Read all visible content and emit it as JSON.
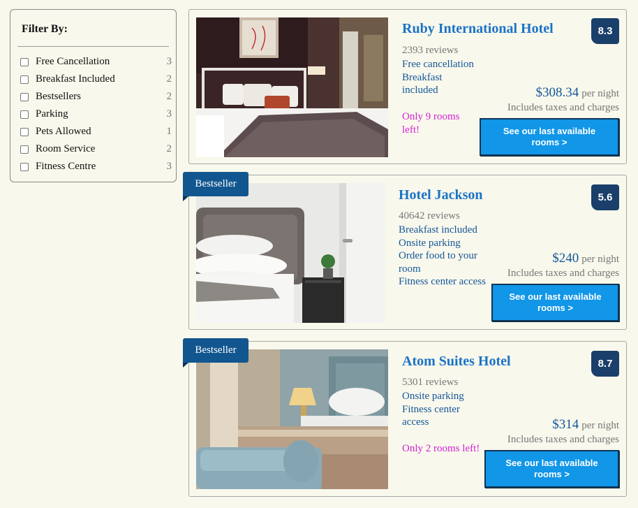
{
  "filter": {
    "title": "Filter By:",
    "options": [
      {
        "label": "Free Cancellation",
        "count": "3"
      },
      {
        "label": "Breakfast Included",
        "count": "2"
      },
      {
        "label": "Bestsellers",
        "count": "2"
      },
      {
        "label": "Parking",
        "count": "3"
      },
      {
        "label": "Pets Allowed",
        "count": "1"
      },
      {
        "label": "Room Service",
        "count": "2"
      },
      {
        "label": "Fitness Centre",
        "count": "3"
      }
    ]
  },
  "hotels": [
    {
      "name": "Ruby International Hotel",
      "score": "8.3",
      "reviews": "2393 reviews",
      "features": [
        "Free cancellation",
        "Breakfast",
        "included"
      ],
      "scarcity": [
        "Only 9 rooms",
        "left!"
      ],
      "price": "$308.34",
      "per_night": "per night",
      "taxes": "Includes taxes and charges",
      "cta": [
        "See our last available",
        "rooms >"
      ]
    },
    {
      "ribbon": "Bestseller",
      "name": "Hotel Jackson",
      "score": "5.6",
      "reviews": "40642 reviews",
      "features": [
        "Breakfast included",
        "Onsite parking",
        "Order food to your",
        "room",
        "Fitness center access"
      ],
      "price": "$240",
      "per_night": "per night",
      "taxes": "Includes taxes and charges",
      "cta": [
        "See our last available",
        "rooms >"
      ]
    },
    {
      "ribbon": "Bestseller",
      "name": "Atom Suites Hotel",
      "score": "8.7",
      "reviews": "5301 reviews",
      "features": [
        "Onsite parking",
        "Fitness center",
        "access"
      ],
      "scarcity": [
        "Only 2 rooms left!"
      ],
      "price": "$314",
      "per_night": "per night",
      "taxes": "Includes taxes and charges",
      "cta": [
        "See our last available",
        "rooms >"
      ]
    }
  ]
}
